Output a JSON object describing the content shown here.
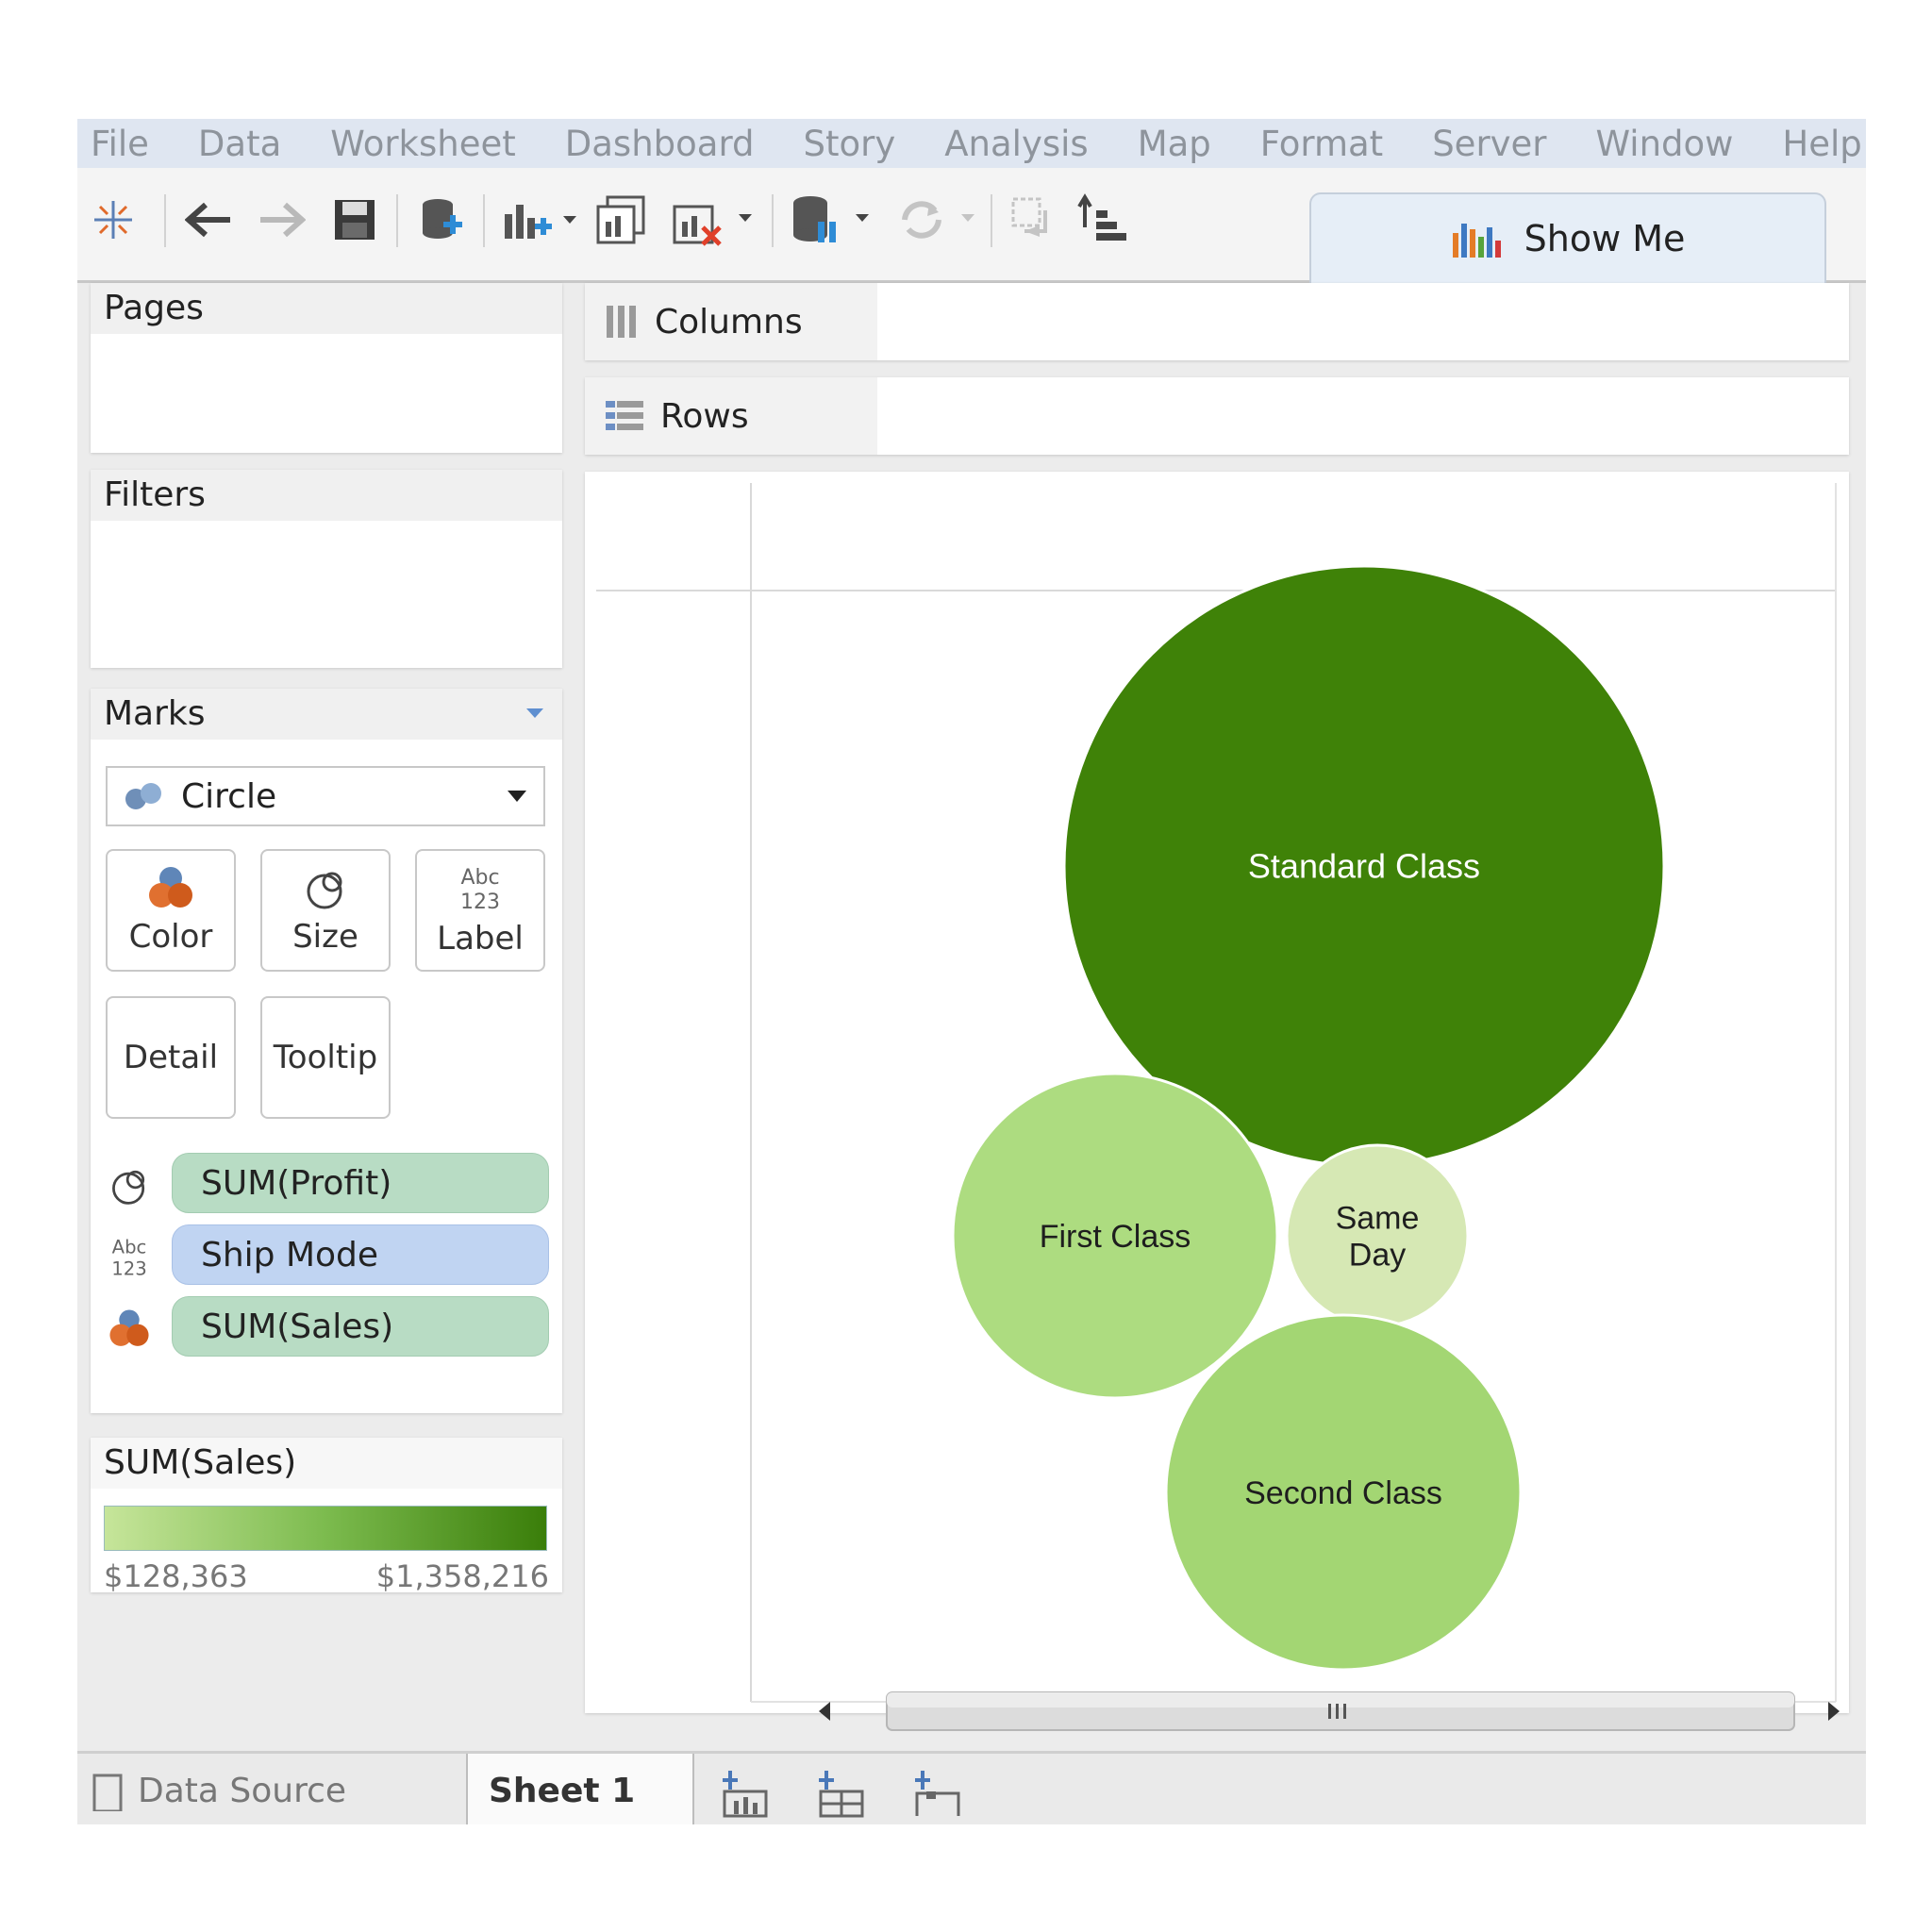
{
  "menu": [
    "File",
    "Data",
    "Worksheet",
    "Dashboard",
    "Story",
    "Analysis",
    "Map",
    "Format",
    "Server",
    "Window",
    "Help"
  ],
  "toolbar": {
    "show_me_label": "Show Me"
  },
  "shelves": {
    "pages_label": "Pages",
    "filters_label": "Filters",
    "columns_label": "Columns",
    "rows_label": "Rows"
  },
  "marks": {
    "title": "Marks",
    "mark_type": "Circle",
    "buttons": {
      "color": "Color",
      "size": "Size",
      "label": "Label",
      "detail": "Detail",
      "tooltip": "Tooltip"
    },
    "label_icon_text": "Abc\n123",
    "pills": [
      {
        "icon": "size-icon",
        "text": "SUM(Profit)",
        "kind": "measure"
      },
      {
        "icon": "label-icon",
        "text": "Ship Mode",
        "kind": "dimension"
      },
      {
        "icon": "color-icon",
        "text": "SUM(Sales)",
        "kind": "measure"
      }
    ]
  },
  "legend": {
    "title": "SUM(Sales)",
    "min_label": "$128,363",
    "max_label": "$1,358,216",
    "colors": [
      "#c6e59a",
      "#3a7e0a"
    ]
  },
  "chart_data": {
    "type": "packed-bubble",
    "size_by": "SUM(Profit)",
    "color_by": "SUM(Sales)",
    "label_by": "Ship Mode",
    "bubbles": [
      {
        "label": "Standard Class",
        "color": "#3f8208"
      },
      {
        "label": "First Class",
        "color": "#addc80"
      },
      {
        "label": "Same Day",
        "color": "#d6e8b4"
      },
      {
        "label": "Second Class",
        "color": "#a3d673"
      }
    ]
  },
  "tabs": {
    "data_source": "Data Source",
    "sheet": "Sheet 1"
  },
  "colors": {
    "menu_bg": "#dfe6f1",
    "measure_pill": "#b8dcc4",
    "dimension_pill": "#c0d4f2"
  }
}
